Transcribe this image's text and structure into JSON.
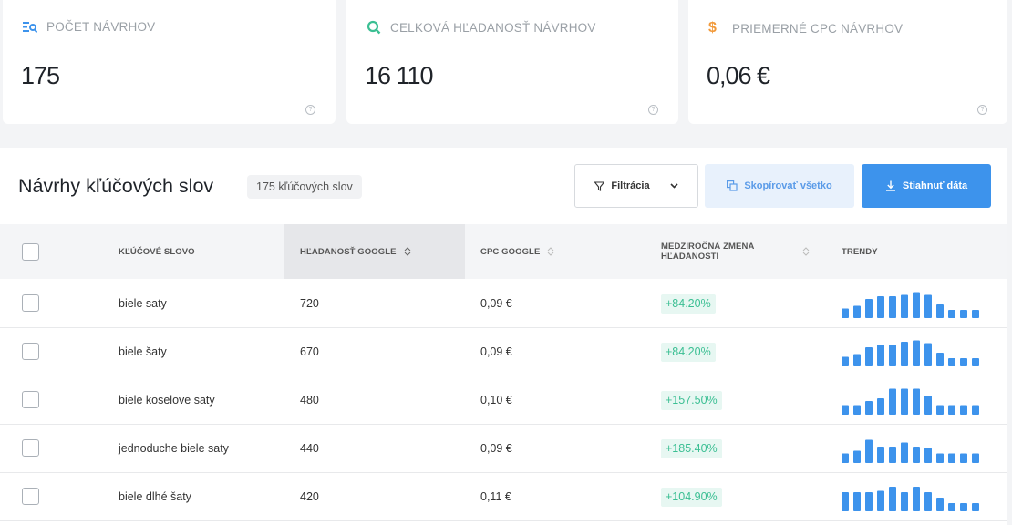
{
  "cards": [
    {
      "label": "POČET NÁVRHOV",
      "value": "175",
      "icon": "list-search-icon"
    },
    {
      "label": "CELKOVÁ HĽADANOSŤ NÁVRHOV",
      "value": "16 110",
      "icon": "search-icon"
    },
    {
      "label": "PRIEMERNÉ CPC NÁVRHOV",
      "value": "0,06 €",
      "icon": "dollar-icon"
    }
  ],
  "panel": {
    "title": "Návrhy kľúčových slov",
    "count_badge": "175 kľúčových slov",
    "filter_label": "Filtrácia",
    "copy_label": "Skopírovať všetko",
    "download_label": "Stiahnuť dáta"
  },
  "table": {
    "headers": {
      "keyword": "KĽÚČOVÉ SLOVO",
      "google_search": "HĽADANOSŤ GOOGLE",
      "cpc": "CPC GOOGLE",
      "yoy_line1": "MEDZIROČNÁ ZMENA",
      "yoy_line2": "HĽADANOSTI",
      "trends": "TRENDY"
    },
    "rows": [
      {
        "keyword": "biele saty",
        "search": "720",
        "cpc": "0,09 €",
        "change": "+84.20%",
        "trend": [
          0.35,
          0.45,
          0.7,
          0.8,
          0.8,
          0.85,
          0.95,
          0.85,
          0.5,
          0.3,
          0.3,
          0.3
        ]
      },
      {
        "keyword": "biele šaty",
        "search": "670",
        "cpc": "0,09 €",
        "change": "+84.20%",
        "trend": [
          0.35,
          0.45,
          0.7,
          0.8,
          0.8,
          0.9,
          0.95,
          0.85,
          0.5,
          0.3,
          0.3,
          0.3
        ]
      },
      {
        "keyword": "biele koselove saty",
        "search": "480",
        "cpc": "0,10 €",
        "change": "+157.50%",
        "trend": [
          0.35,
          0.35,
          0.5,
          0.6,
          0.95,
          0.95,
          0.95,
          0.7,
          0.35,
          0.35,
          0.35,
          0.35
        ]
      },
      {
        "keyword": "jednoduche biele saty",
        "search": "440",
        "cpc": "0,09 €",
        "change": "+185.40%",
        "trend": [
          0.35,
          0.45,
          0.85,
          0.6,
          0.6,
          0.75,
          0.6,
          0.55,
          0.35,
          0.35,
          0.35,
          0.35
        ]
      },
      {
        "keyword": "biele dlhé šaty",
        "search": "420",
        "cpc": "0,11 €",
        "change": "+104.90%",
        "trend": [
          0.7,
          0.7,
          0.7,
          0.75,
          0.9,
          0.7,
          0.9,
          0.7,
          0.5,
          0.3,
          0.3,
          0.3
        ]
      }
    ]
  },
  "colors": {
    "accent": "#3d93ec",
    "positive": "#3bbf93",
    "trend_bar": "#3d93ec"
  }
}
